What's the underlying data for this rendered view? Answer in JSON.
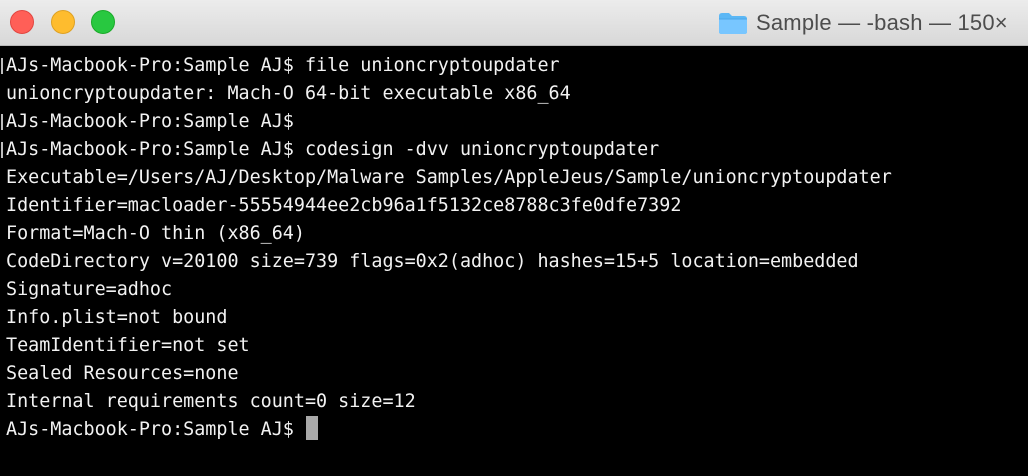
{
  "window": {
    "title": "Sample — -bash — 150×",
    "colors": {
      "background": "#000000",
      "text": "#f2f2f2",
      "close": "#ff5f57",
      "minimize": "#febc2e",
      "zoom": "#28c840"
    },
    "folder_icon": "folder-icon"
  },
  "terminal": {
    "lines": [
      {
        "text": "AJs-Macbook-Pro:Sample AJ$ file unioncryptoupdater",
        "kind": "prompt"
      },
      {
        "text": "unioncryptoupdater: Mach-O 64-bit executable x86_64",
        "kind": "output"
      },
      {
        "text": "AJs-Macbook-Pro:Sample AJ$",
        "kind": "prompt"
      },
      {
        "text": "AJs-Macbook-Pro:Sample AJ$ codesign -dvv unioncryptoupdater",
        "kind": "prompt"
      },
      {
        "text": "Executable=/Users/AJ/Desktop/Malware Samples/AppleJeus/Sample/unioncryptoupdater",
        "kind": "output"
      },
      {
        "text": "Identifier=macloader-55554944ee2cb96a1f5132ce8788c3fe0dfe7392",
        "kind": "output"
      },
      {
        "text": "Format=Mach-O thin (x86_64)",
        "kind": "output"
      },
      {
        "text": "CodeDirectory v=20100 size=739 flags=0x2(adhoc) hashes=15+5 location=embedded",
        "kind": "output"
      },
      {
        "text": "Signature=adhoc",
        "kind": "output"
      },
      {
        "text": "Info.plist=not bound",
        "kind": "output"
      },
      {
        "text": "TeamIdentifier=not set",
        "kind": "output"
      },
      {
        "text": "Sealed Resources=none",
        "kind": "output"
      },
      {
        "text": "Internal requirements count=0 size=12",
        "kind": "output"
      }
    ],
    "current_prompt": "AJs-Macbook-Pro:Sample AJ$ "
  }
}
